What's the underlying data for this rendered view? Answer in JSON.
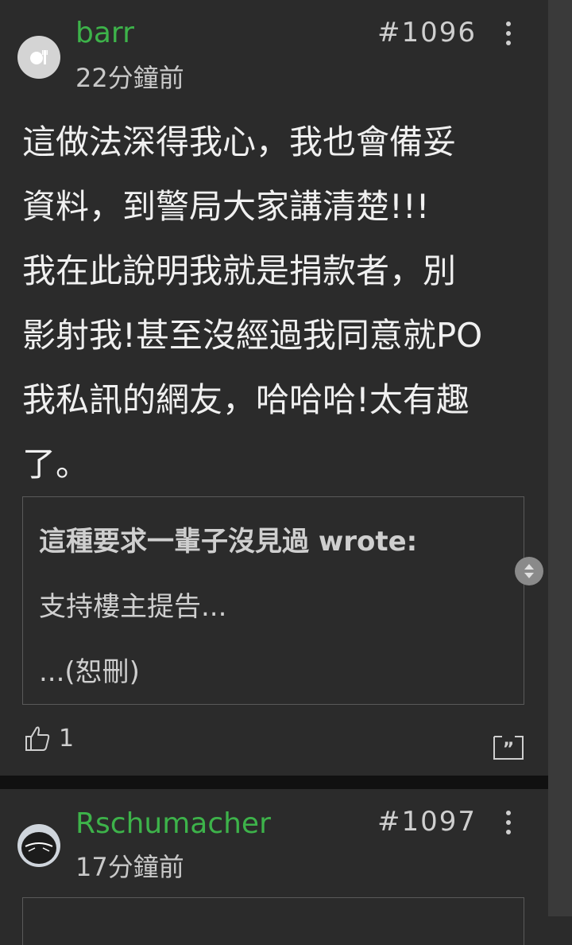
{
  "posts": [
    {
      "username": "barr",
      "time": "22分鐘前",
      "floor": "#1096",
      "content_lines": [
        "這做法深得我心，我也會備妥",
        "資料，到警局大家講清楚!!!",
        "我在此說明我就是捐款者，別",
        "影射我!甚至沒經過我同意就PO",
        "我私訊的網友，哈哈哈!太有趣",
        "了。"
      ],
      "quote": {
        "author": "這種要求一輩子沒見過 wrote:",
        "line1": "支持樓主提告...",
        "line2": "...(恕刪)"
      },
      "likes": "1",
      "icons": {
        "avatar": "fork-knife-avatar-icon",
        "more": "more-vertical-icon",
        "like": "thumbs-up-icon",
        "quote_reply": "quote-reply-icon"
      }
    },
    {
      "username": "Rschumacher",
      "time": "17分鐘前",
      "floor": "#1097",
      "icons": {
        "avatar": "helmet-avatar-icon",
        "more": "more-vertical-icon"
      }
    }
  ],
  "colors": {
    "background": "#2b2b2b",
    "username": "#3db34a",
    "separator": "#111111"
  }
}
